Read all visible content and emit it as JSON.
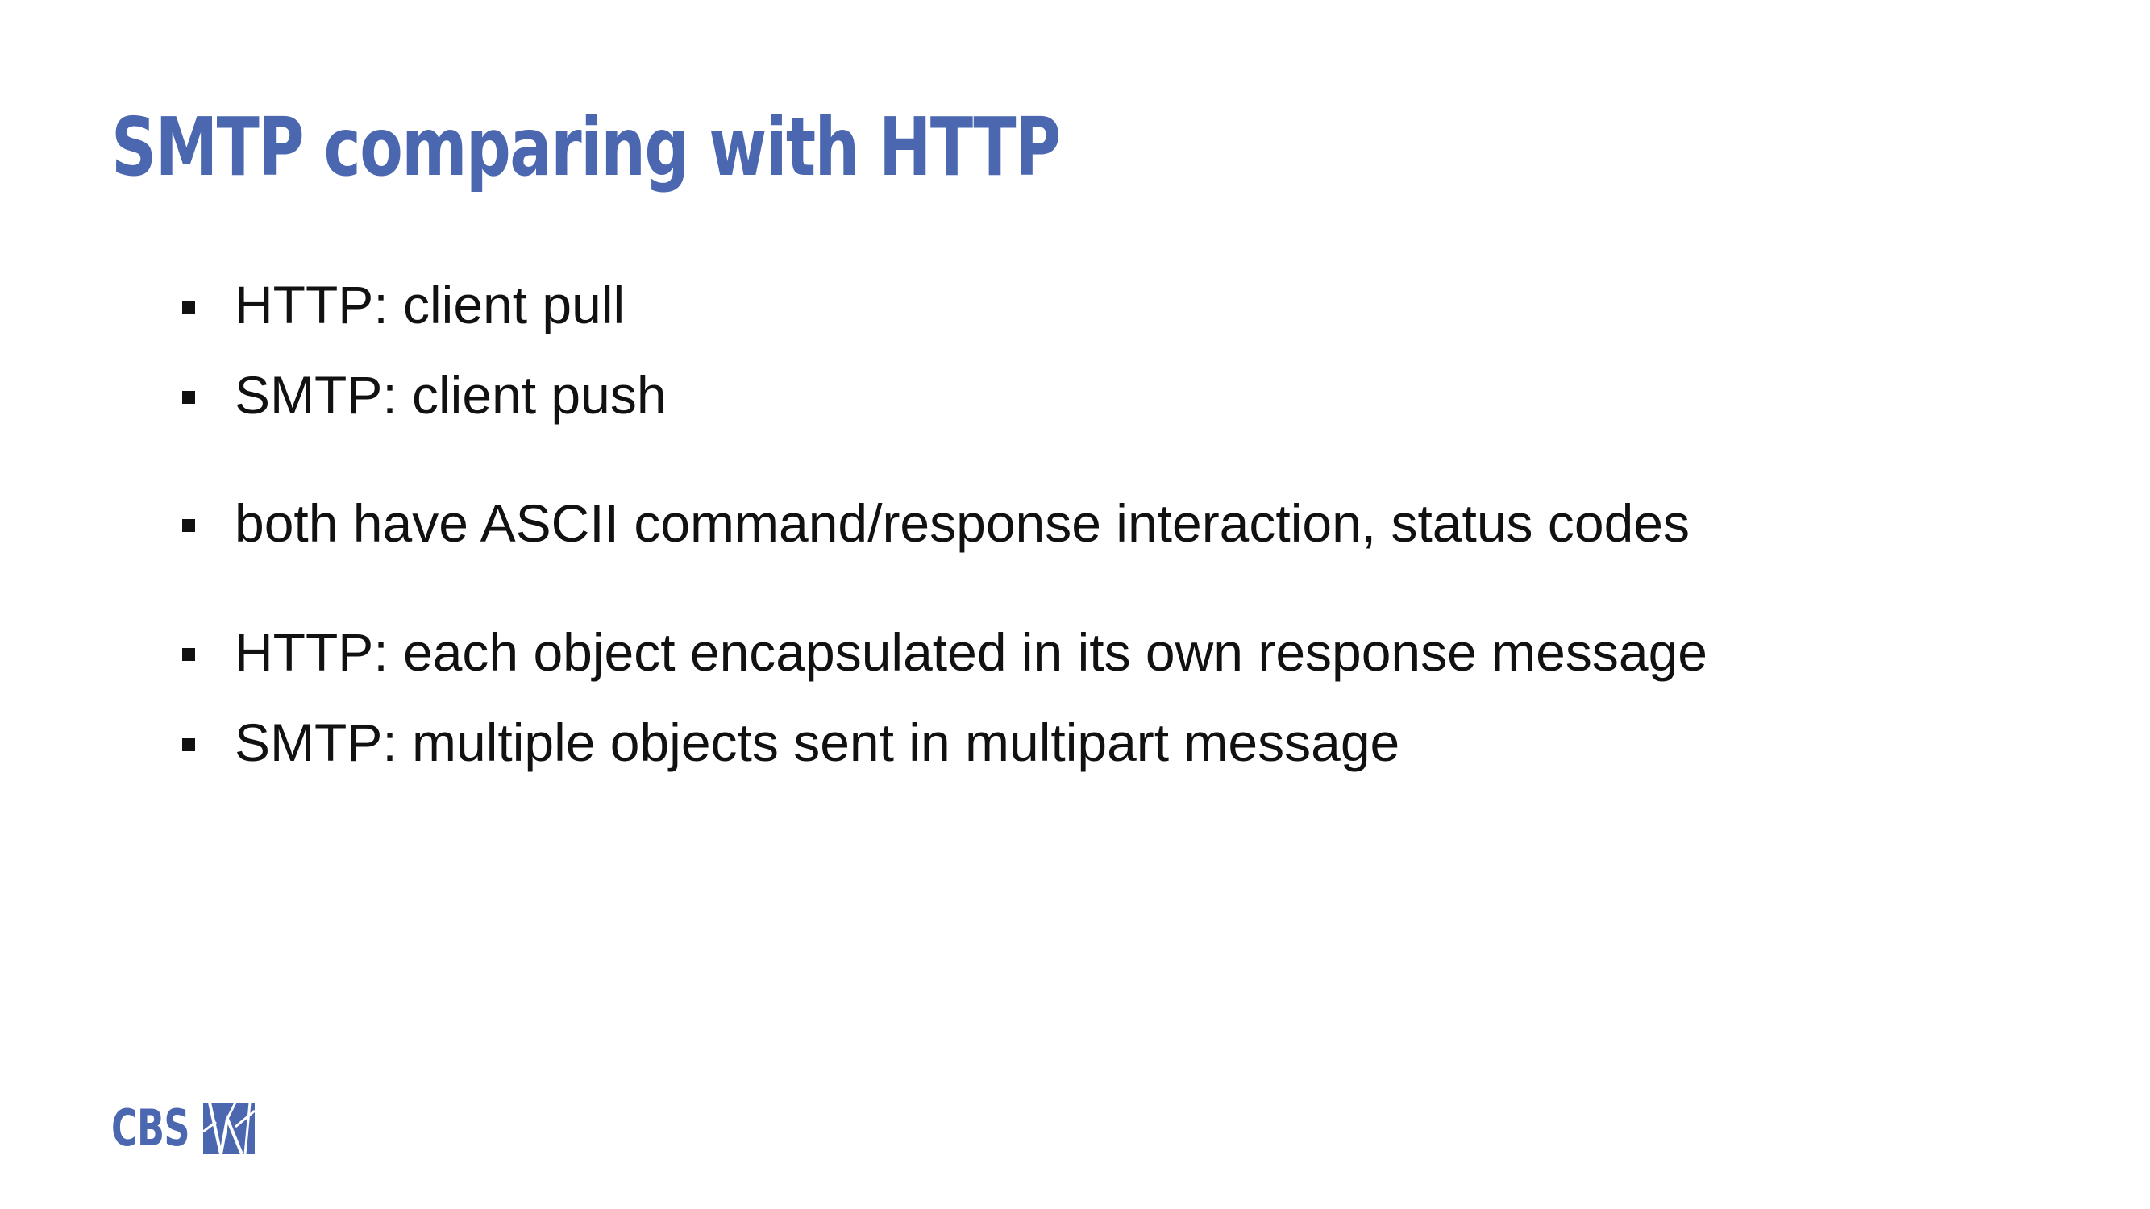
{
  "slide": {
    "title": "SMTP comparing with HTTP",
    "bullets": [
      "HTTP: client pull",
      "SMTP: client push",
      "both have ASCII command/response interaction, status codes",
      "HTTP: each object encapsulated in its own response message",
      "SMTP: multiple objects sent in multipart message"
    ]
  },
  "logo": {
    "text": "CBS",
    "icon": "cbs-logo-mark-icon"
  },
  "colors": {
    "accent": "#4a67b0",
    "text": "#111111",
    "background": "#ffffff"
  }
}
